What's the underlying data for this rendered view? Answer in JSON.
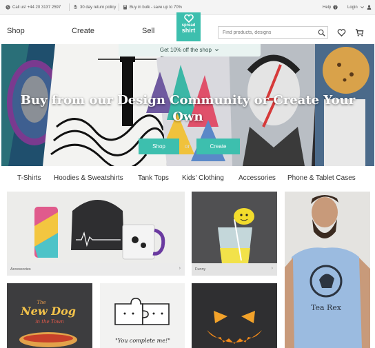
{
  "topbar": {
    "phone": "Call us! +44 20 3137 2597",
    "return_policy": "30 day return policy",
    "bulk": "Buy in bulk - save up to 70%",
    "help": "Help",
    "login": "Login"
  },
  "header": {
    "nav": [
      "Shop",
      "Create",
      "Sell"
    ],
    "logo_line1": "spread",
    "logo_line2": "shirt",
    "search_placeholder": "Find products, designs"
  },
  "hero": {
    "promo": "Get 10% off the shop",
    "title": "Buy from our Design Community or Create Your Own",
    "shop_button": "Shop",
    "or": "or",
    "create_button": "Create"
  },
  "categories": [
    "T-Shirts",
    "Hoodies & Sweatshirts",
    "Tank Tops",
    "Kids' Clothing",
    "Accessories",
    "Phone & Tablet Cases"
  ],
  "tiles": {
    "accessories": "Accessories",
    "funny": "Funny",
    "tea_rex": "Tea Rex",
    "new_dog_line1": "The",
    "new_dog_line2": "New Dog",
    "new_dog_line3": "in the Town",
    "puzzle": "\"You complete me!\""
  },
  "colors": {
    "brand": "#3dbfae",
    "topbar_bg": "#f4f4f4",
    "hero_bg": "#2c2c30"
  }
}
